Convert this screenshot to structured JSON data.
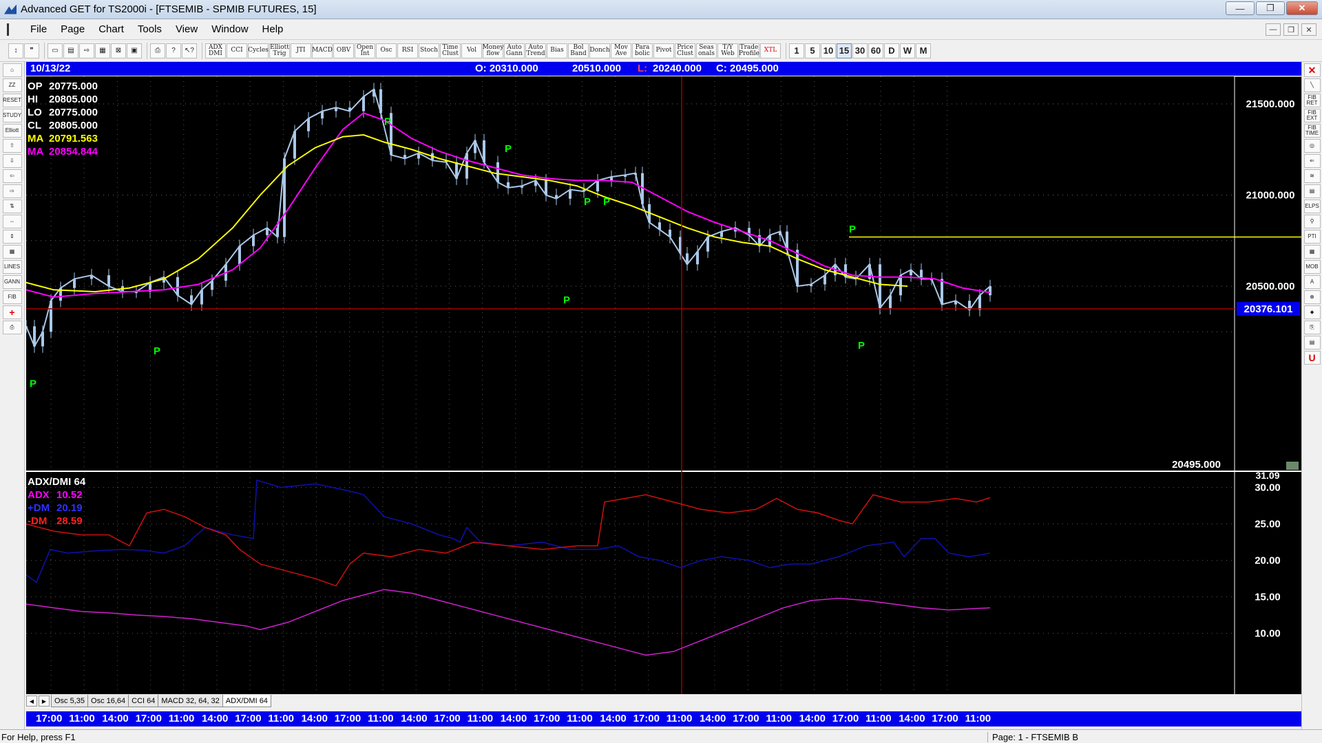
{
  "window": {
    "title": "Advanced GET for TS2000i - [FTSEMIB - SPMIB FUTURES, 15]",
    "controls": [
      "—",
      "❐",
      "✕"
    ]
  },
  "menu": {
    "items": [
      "File",
      "Page",
      "Chart",
      "Tools",
      "View",
      "Window",
      "Help"
    ]
  },
  "toolbar": {
    "indicators": [
      "ADX DMI",
      "CCI",
      "Cycles",
      "Elliott Trig",
      "JTI",
      "MACD",
      "OBV",
      "Open Int",
      "Osc",
      "RSI",
      "Stoch",
      "Time Clust",
      "Vol",
      "Money flow",
      "Auto Gann",
      "Auto Trend",
      "Bias",
      "Bol Band",
      "Donch",
      "Mov Ave",
      "Para bolic",
      "Pivot",
      "Price Clust",
      "Seas onals",
      "T/Y Web",
      "Trade Profile",
      "XTL"
    ],
    "timeframes": [
      "1",
      "5",
      "10",
      "15",
      "30",
      "60",
      "D",
      "W",
      "M"
    ],
    "active_timeframe": "15"
  },
  "left_tools": [
    "⌂",
    "ZZ",
    "RESET",
    "STUDY",
    "Elliott",
    "⇧",
    "⇩",
    "⇦",
    "⇨",
    "⇅",
    "⇔",
    "⇕",
    "▦",
    "LINES",
    "GANN",
    "FIB",
    "+",
    "⎙"
  ],
  "right_tools": [
    "✕",
    "╲",
    "FIB RET",
    "FIB EXT",
    "FIB TIME",
    "◎",
    "⇐",
    "≋",
    "▤",
    "ELPS",
    "⚲",
    "PTI",
    "▦",
    "MOB",
    "A",
    "⊕",
    "⬥",
    "⎘",
    "▤",
    "U"
  ],
  "info_bar": {
    "date": "10/13/22",
    "open": "O: 20310.000",
    "high": "20510.000",
    "low_label": "L:",
    "low": "20240.000",
    "close": "C: 20495.000"
  },
  "price_panel": {
    "readout": [
      {
        "label": "OP",
        "value": "20775.000",
        "color": "#ffffff"
      },
      {
        "label": "HI",
        "value": "20805.000",
        "color": "#ffffff"
      },
      {
        "label": "LO",
        "value": "20775.000",
        "color": "#ffffff"
      },
      {
        "label": "CL",
        "value": "20805.000",
        "color": "#ffffff"
      },
      {
        "label": "MA",
        "value": "20791.563",
        "color": "#ffff00"
      },
      {
        "label": "MA",
        "value": "20854.844",
        "color": "#ff00ff"
      }
    ],
    "y_ticks": [
      "21500.000",
      "21000.000",
      "20500.000"
    ],
    "cursor_price": "20376.101",
    "last_price": "20495.000",
    "pivot_label": "P"
  },
  "indicator_panel": {
    "title": "ADX/DMI 64",
    "readout": [
      {
        "label": "ADX",
        "value": "10.52",
        "color": "#ff00ff"
      },
      {
        "label": "+DM",
        "value": "20.19",
        "color": "#3030ff"
      },
      {
        "label": "-DM",
        "value": "28.59",
        "color": "#ff2020"
      }
    ],
    "top_value": "31.09",
    "y_ticks": [
      "30.00",
      "25.00",
      "20.00",
      "15.00",
      "10.00"
    ]
  },
  "tabs": [
    {
      "label": "Osc 5,35",
      "active": false
    },
    {
      "label": "Osc 16,64",
      "active": false
    },
    {
      "label": "CCI 64",
      "active": false
    },
    {
      "label": "MACD 32, 64, 32",
      "active": false
    },
    {
      "label": "ADX/DMI 64",
      "active": true
    }
  ],
  "time_axis": [
    "17:00",
    "11:00",
    "14:00",
    "17:00",
    "11:00",
    "14:00",
    "17:00",
    "11:00",
    "14:00",
    "17:00",
    "11:00",
    "14:00",
    "17:00",
    "11:00",
    "14:00",
    "17:00",
    "11:00",
    "14:00",
    "17:00",
    "11:00",
    "14:00",
    "17:00",
    "11:00",
    "14:00",
    "17:00",
    "11:00",
    "14:00",
    "17:00",
    "11:00"
  ],
  "status": {
    "left": "For Help, press F1",
    "right": "Page: 1 - FTSEMIB B"
  },
  "colors": {
    "ma_fast": "#ffff00",
    "ma_slow": "#ff00ff",
    "pivot": "#00ff00",
    "candles": "#aac8e8",
    "plus_dm": "#1010b0",
    "minus_dm": "#d01010",
    "adx": "#d020d0",
    "cursor": "#a00000"
  }
}
